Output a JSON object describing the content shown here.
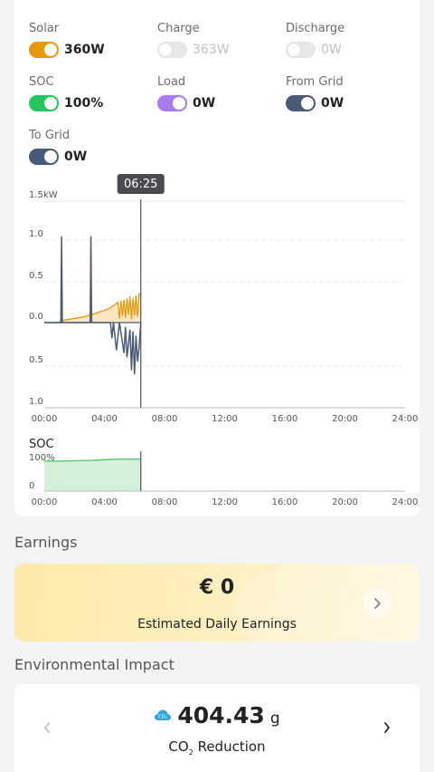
{
  "toggles": [
    {
      "label": "Solar",
      "value": "360W",
      "on": true,
      "color": "#e69a0a"
    },
    {
      "label": "Charge",
      "value": "363W",
      "on": false,
      "color": "#e7e7ea"
    },
    {
      "label": "Discharge",
      "value": "0W",
      "on": false,
      "color": "#e7e7ea"
    },
    {
      "label": "SOC",
      "value": "100%",
      "on": true,
      "color": "#22c55e"
    },
    {
      "label": "Load",
      "value": "0W",
      "on": true,
      "color": "#a77bf0"
    },
    {
      "label": "From Grid",
      "value": "0W",
      "on": true,
      "color": "#4a5b78"
    },
    {
      "label": "To Grid",
      "value": "0W",
      "on": true,
      "color": "#4a5b78"
    }
  ],
  "chart_data": [
    {
      "type": "line",
      "tooltip_time": "06:25",
      "cursor_hour": 6.42,
      "y_tick_labels": [
        "1.5kW",
        "1.0",
        "0.5",
        "0.0",
        "0.5",
        "1.0"
      ],
      "y_ticks": [
        1.5,
        1.0,
        0.5,
        0.0,
        -0.5,
        -1.0
      ],
      "ylim": [
        -1.0,
        1.5
      ],
      "xlim": [
        0,
        24
      ],
      "x_tick_labels": [
        "00:00",
        "04:00",
        "08:00",
        "12:00",
        "16:00",
        "20:00",
        "24:00"
      ],
      "series": [
        {
          "name": "Solar",
          "color": "#e69a0a",
          "x": [
            0,
            1.0,
            1.1,
            1.3,
            2.0,
            2.6,
            3.0,
            3.5,
            4.0,
            4.3,
            4.5,
            4.7,
            4.9,
            5.0,
            5.1,
            5.2,
            5.3,
            5.4,
            5.5,
            5.6,
            5.7,
            5.8,
            5.9,
            6.0,
            6.1,
            6.2,
            6.3,
            6.42
          ],
          "values": [
            0,
            0,
            0.02,
            0.03,
            0.05,
            0.07,
            0.09,
            0.12,
            0.15,
            0.17,
            0.2,
            0.22,
            0.25,
            0.05,
            0.27,
            0.08,
            0.28,
            0.06,
            0.3,
            0.1,
            0.32,
            0.04,
            0.3,
            0.09,
            0.33,
            0.07,
            0.35,
            0.36
          ]
        },
        {
          "name": "Grid",
          "color": "#4a5b78",
          "x": [
            0,
            1.1,
            1.15,
            1.2,
            3.05,
            3.1,
            3.15,
            4.4,
            4.5,
            4.6,
            4.8,
            5.0,
            5.3,
            5.4,
            5.5,
            5.7,
            5.8,
            5.9,
            6.0,
            6.1,
            6.2,
            6.3,
            6.42
          ],
          "values": [
            0,
            0,
            1.05,
            0,
            0,
            1.05,
            0,
            0,
            -0.18,
            0,
            -0.32,
            0,
            -0.35,
            -0.05,
            -0.4,
            -0.08,
            -0.55,
            -0.1,
            -0.6,
            -0.15,
            -0.45,
            -0.3,
            0
          ]
        }
      ]
    },
    {
      "type": "area",
      "title": "SOC",
      "y_tick_labels": [
        "100%",
        "0"
      ],
      "ylim": [
        0,
        100
      ],
      "xlim": [
        0,
        24
      ],
      "x_tick_labels": [
        "00:00",
        "04:00",
        "08:00",
        "12:00",
        "16:00",
        "20:00",
        "24:00"
      ],
      "series": [
        {
          "name": "SOC",
          "color": "#4cc56b",
          "x": [
            0,
            1,
            2,
            3,
            4,
            4.5,
            5,
            5.5,
            6,
            6.42
          ],
          "values": [
            92,
            92,
            93,
            94,
            96,
            97,
            98,
            98,
            98,
            98
          ]
        }
      ]
    }
  ],
  "earnings": {
    "section_title": "Earnings",
    "value": "€ 0",
    "label": "Estimated Daily Earnings"
  },
  "environment": {
    "section_title": "Environmental Impact",
    "co2_badge": "CO₂",
    "value": "404.43",
    "unit": "g",
    "label_main": "CO",
    "label_sub": "2",
    "label_rest": " Reduction"
  }
}
